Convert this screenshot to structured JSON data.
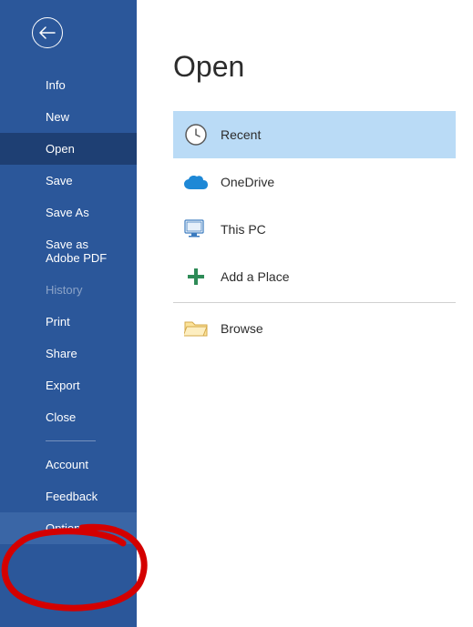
{
  "page": {
    "title": "Open"
  },
  "sidebar": {
    "items": [
      {
        "label": "Info",
        "state": ""
      },
      {
        "label": "New",
        "state": ""
      },
      {
        "label": "Open",
        "state": "active"
      },
      {
        "label": "Save",
        "state": ""
      },
      {
        "label": "Save As",
        "state": ""
      },
      {
        "label": "Save as Adobe PDF",
        "state": ""
      },
      {
        "label": "History",
        "state": "disabled"
      },
      {
        "label": "Print",
        "state": ""
      },
      {
        "label": "Share",
        "state": ""
      },
      {
        "label": "Export",
        "state": ""
      },
      {
        "label": "Close",
        "state": ""
      },
      {
        "label": "Account",
        "state": ""
      },
      {
        "label": "Feedback",
        "state": ""
      },
      {
        "label": "Options",
        "state": "highlight"
      }
    ]
  },
  "locations": [
    {
      "label": "Recent",
      "icon": "clock",
      "selected": true
    },
    {
      "label": "OneDrive",
      "icon": "cloud",
      "selected": false
    },
    {
      "label": "This PC",
      "icon": "pc",
      "selected": false
    },
    {
      "label": "Add a Place",
      "icon": "plus",
      "selected": false
    },
    {
      "label": "Browse",
      "icon": "folder",
      "selected": false
    }
  ]
}
